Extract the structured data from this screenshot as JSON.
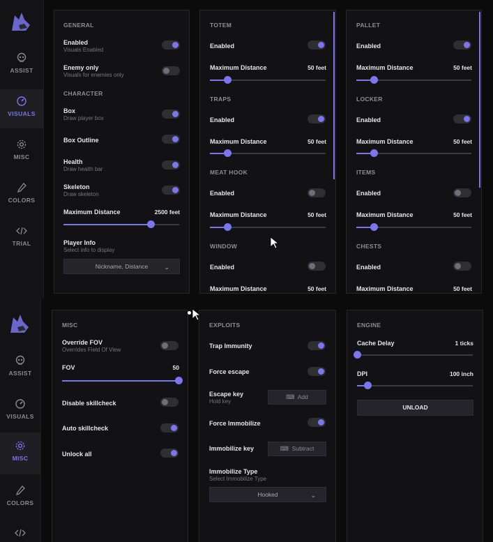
{
  "sidebar": {
    "items": [
      {
        "label": "ASSIST",
        "icon": "skull-icon"
      },
      {
        "label": "VISUALS",
        "icon": "eye-icon"
      },
      {
        "label": "MISC",
        "icon": "gear-icon"
      },
      {
        "label": "COLORS",
        "icon": "dropper-icon"
      },
      {
        "label": "TRIAL",
        "icon": "code-icon"
      }
    ],
    "active_top": "VISUALS",
    "active_bottom": "MISC"
  },
  "general": {
    "title": "GENERAL",
    "enabled": {
      "label": "Enabled",
      "sub": "Visuals Enabled",
      "on": true
    },
    "enemy_only": {
      "label": "Enemy only",
      "sub": "Visuals for enemies only",
      "on": false
    }
  },
  "character": {
    "title": "CHARACTER",
    "box": {
      "label": "Box",
      "sub": "Draw player box",
      "on": true
    },
    "box_outline": {
      "label": "Box Outline",
      "on": true
    },
    "health": {
      "label": "Health",
      "sub": "Draw health bar",
      "on": true
    },
    "skeleton": {
      "label": "Skeleton",
      "sub": "Draw skeleton",
      "on": true
    },
    "max_distance": {
      "label": "Maximum Distance",
      "value": "2500 feet",
      "fraction": 0.75
    },
    "player_info": {
      "label": "Player Info",
      "sub": "Select info to display",
      "selected": "Nickname, Distance"
    }
  },
  "totem": {
    "title": "TOTEM",
    "enabled_label": "Enabled",
    "on": true,
    "dist_label": "Maximum Distance",
    "dist_value": "50 feet",
    "fraction": 0.15
  },
  "traps": {
    "title": "TRAPS",
    "enabled_label": "Enabled",
    "on": true,
    "dist_label": "Maximum Distance",
    "dist_value": "50 feet",
    "fraction": 0.15
  },
  "meat_hook": {
    "title": "MEAT HOOK",
    "enabled_label": "Enabled",
    "on": false,
    "dist_label": "Maximum Distance",
    "dist_value": "50 feet",
    "fraction": 0.15
  },
  "window": {
    "title": "WINDOW",
    "enabled_label": "Enabled",
    "on": false,
    "dist_label": "Maximum Distance",
    "dist_value": "50 feet"
  },
  "pallet": {
    "title": "PALLET",
    "enabled_label": "Enabled",
    "on": true,
    "dist_label": "Maximum Distance",
    "dist_value": "50 feet",
    "fraction": 0.15
  },
  "locker": {
    "title": "LOCKER",
    "enabled_label": "Enabled",
    "on": true,
    "dist_label": "Maximum Distance",
    "dist_value": "50 feet",
    "fraction": 0.15
  },
  "items": {
    "title": "ITEMS",
    "enabled_label": "Enabled",
    "on": false,
    "dist_label": "Maximum Distance",
    "dist_value": "50 feet",
    "fraction": 0.15
  },
  "chests": {
    "title": "CHESTS",
    "enabled_label": "Enabled",
    "on": false,
    "dist_label": "Maximum Distance",
    "dist_value": "50 feet"
  },
  "misc": {
    "title": "MISC",
    "override_fov": {
      "label": "Override FOV",
      "sub": "Overrides Field Of View",
      "on": false
    },
    "fov": {
      "label": "FOV",
      "value": "50",
      "fraction": 1.0
    },
    "disable_skillcheck": {
      "label": "Disable skillcheck",
      "on": false
    },
    "auto_skillcheck": {
      "label": "Auto skillcheck",
      "on": true
    },
    "unlock_all": {
      "label": "Unlock all",
      "on": true
    }
  },
  "exploits": {
    "title": "EXPLOITS",
    "trap_immunity": {
      "label": "Trap Immunity",
      "on": true
    },
    "force_escape": {
      "label": "Force escape",
      "on": true
    },
    "escape_key": {
      "label": "Escape key",
      "sub": "Hold key",
      "button": "Add"
    },
    "force_immobilize": {
      "label": "Force Immobilize",
      "on": true
    },
    "immobilize_key": {
      "label": "Immobilize key",
      "button": "Subtract"
    },
    "immobilize_type": {
      "label": "Immobilize Type",
      "sub": "Select Immobilize Type",
      "selected": "Hooked"
    }
  },
  "engine": {
    "title": "ENGINE",
    "cache_delay": {
      "label": "Cache Delay",
      "value": "1 ticks",
      "fraction": 0.0
    },
    "dpi": {
      "label": "DPI",
      "value": "100 inch",
      "fraction": 0.09
    },
    "unload": "UNLOAD"
  },
  "colors": {
    "accent": "#7b76ee",
    "panel": "#121214",
    "background": "#0b0b0c",
    "toggle_off": "#2e2e33"
  }
}
